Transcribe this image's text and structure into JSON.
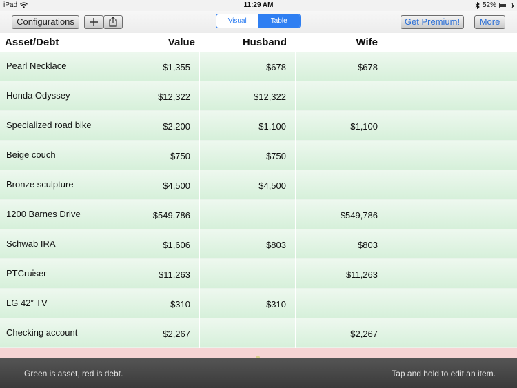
{
  "status": {
    "device": "iPad",
    "time": "11:29 AM",
    "battery": "52%",
    "battery_level": 0.52
  },
  "toolbar": {
    "configurations_label": "Configurations",
    "add_icon": "plus-icon",
    "share_icon": "share-icon",
    "segments": [
      "Visual",
      "Table"
    ],
    "selected_segment": "Table",
    "premium_label": "Get Premium!",
    "more_label": "More"
  },
  "table": {
    "headers": [
      "Asset/Debt",
      "Value",
      "Husband",
      "Wife"
    ],
    "rows": [
      {
        "name": "Pearl Necklace",
        "value": "$1,355",
        "husband": "$678",
        "wife": "$678"
      },
      {
        "name": "Honda Odyssey",
        "value": "$12,322",
        "husband": "$12,322",
        "wife": ""
      },
      {
        "name": "Specialized road bike",
        "value": "$2,200",
        "husband": "$1,100",
        "wife": "$1,100"
      },
      {
        "name": "Beige couch",
        "value": "$750",
        "husband": "$750",
        "wife": ""
      },
      {
        "name": "Bronze sculpture",
        "value": "$4,500",
        "husband": "$4,500",
        "wife": ""
      },
      {
        "name": "1200 Barnes Drive",
        "value": "$549,786",
        "husband": "",
        "wife": "$549,786"
      },
      {
        "name": "Schwab IRA",
        "value": "$1,606",
        "husband": "$803",
        "wife": "$803"
      },
      {
        "name": "PTCruiser",
        "value": "$11,263",
        "husband": "",
        "wife": "$11,263"
      },
      {
        "name": "LG 42” TV",
        "value": "$310",
        "husband": "$310",
        "wife": ""
      },
      {
        "name": "Checking account",
        "value": "$2,267",
        "husband": "",
        "wife": "$2,267"
      }
    ]
  },
  "footer": {
    "left": "Green is asset, red is debt.",
    "right": "Tap and hold to edit an item."
  }
}
